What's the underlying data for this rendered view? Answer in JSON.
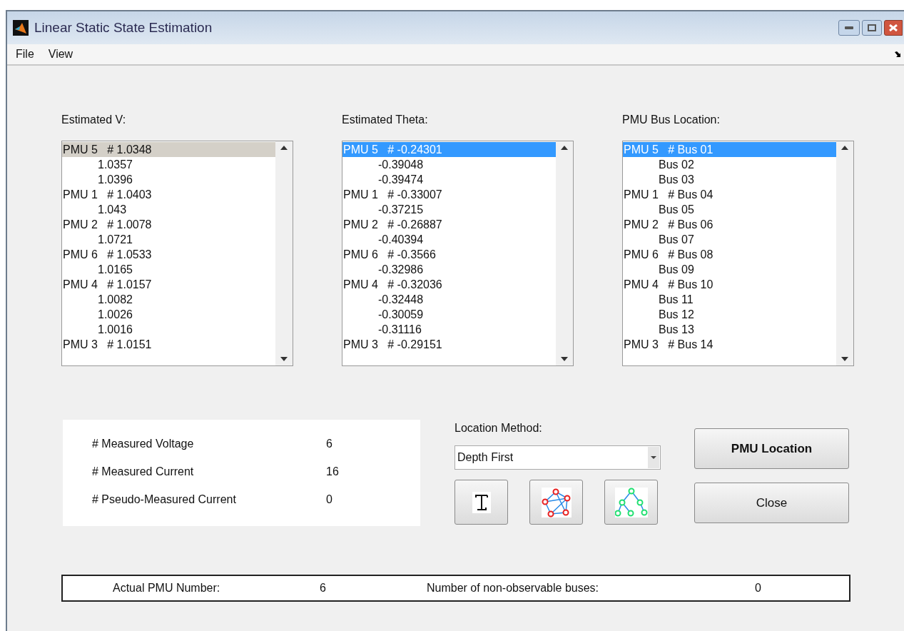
{
  "window": {
    "title": "Linear Static State Estimation"
  },
  "menu": [
    "File",
    "View"
  ],
  "lists": [
    {
      "label": "Estimated V:",
      "focused": false,
      "rows": [
        {
          "kind": "pmu",
          "text": "PMU 5   # 1.0348",
          "selected": true
        },
        {
          "kind": "value",
          "text": "1.0357",
          "selected": false
        },
        {
          "kind": "value",
          "text": "1.0396",
          "selected": false
        },
        {
          "kind": "pmu",
          "text": "PMU 1   # 1.0403",
          "selected": false
        },
        {
          "kind": "value",
          "text": "1.043",
          "selected": false
        },
        {
          "kind": "pmu",
          "text": "PMU 2   # 1.0078",
          "selected": false
        },
        {
          "kind": "value",
          "text": "1.0721",
          "selected": false
        },
        {
          "kind": "pmu",
          "text": "PMU 6   # 1.0533",
          "selected": false
        },
        {
          "kind": "value",
          "text": "1.0165",
          "selected": false
        },
        {
          "kind": "pmu",
          "text": "PMU 4   # 1.0157",
          "selected": false
        },
        {
          "kind": "value",
          "text": "1.0082",
          "selected": false
        },
        {
          "kind": "value",
          "text": "1.0026",
          "selected": false
        },
        {
          "kind": "value",
          "text": "1.0016",
          "selected": false
        },
        {
          "kind": "pmu",
          "text": "PMU 3   # 1.0151",
          "selected": false
        }
      ]
    },
    {
      "label": "Estimated Theta:",
      "focused": true,
      "rows": [
        {
          "kind": "pmu",
          "text": "PMU 5   # -0.24301",
          "selected": true
        },
        {
          "kind": "value",
          "text": "-0.39048",
          "selected": false
        },
        {
          "kind": "value",
          "text": "-0.39474",
          "selected": false
        },
        {
          "kind": "pmu",
          "text": "PMU 1   # -0.33007",
          "selected": false
        },
        {
          "kind": "value",
          "text": "-0.37215",
          "selected": false
        },
        {
          "kind": "pmu",
          "text": "PMU 2   # -0.26887",
          "selected": false
        },
        {
          "kind": "value",
          "text": "-0.40394",
          "selected": false
        },
        {
          "kind": "pmu",
          "text": "PMU 6   # -0.3566",
          "selected": false
        },
        {
          "kind": "value",
          "text": "-0.32986",
          "selected": false
        },
        {
          "kind": "pmu",
          "text": "PMU 4   # -0.32036",
          "selected": false
        },
        {
          "kind": "value",
          "text": "-0.32448",
          "selected": false
        },
        {
          "kind": "value",
          "text": "-0.30059",
          "selected": false
        },
        {
          "kind": "value",
          "text": "-0.31116",
          "selected": false
        },
        {
          "kind": "pmu",
          "text": "PMU 3   # -0.29151",
          "selected": false
        }
      ]
    },
    {
      "label": "PMU Bus Location:",
      "focused": true,
      "rows": [
        {
          "kind": "pmu",
          "text": "PMU 5   # Bus 01",
          "selected": true
        },
        {
          "kind": "value",
          "text": "Bus 02",
          "selected": false
        },
        {
          "kind": "value",
          "text": "Bus 03",
          "selected": false
        },
        {
          "kind": "pmu",
          "text": "PMU 1   # Bus 04",
          "selected": false
        },
        {
          "kind": "value",
          "text": "Bus 05",
          "selected": false
        },
        {
          "kind": "pmu",
          "text": "PMU 2   # Bus 06",
          "selected": false
        },
        {
          "kind": "value",
          "text": "Bus 07",
          "selected": false
        },
        {
          "kind": "pmu",
          "text": "PMU 6   # Bus 08",
          "selected": false
        },
        {
          "kind": "value",
          "text": "Bus 09",
          "selected": false
        },
        {
          "kind": "pmu",
          "text": "PMU 4   # Bus 10",
          "selected": false
        },
        {
          "kind": "value",
          "text": "Bus 11",
          "selected": false
        },
        {
          "kind": "value",
          "text": "Bus 12",
          "selected": false
        },
        {
          "kind": "value",
          "text": "Bus 13",
          "selected": false
        },
        {
          "kind": "pmu",
          "text": "PMU 3   # Bus 14",
          "selected": false
        }
      ]
    }
  ],
  "measurements": [
    {
      "label": "# Measured Voltage",
      "value": "6"
    },
    {
      "label": "# Measured Current",
      "value": "16"
    },
    {
      "label": "# Pseudo-Measured Current",
      "value": "0"
    }
  ],
  "location_method": {
    "label": "Location Method:",
    "value": "Depth First"
  },
  "buttons": [
    "PMU Location",
    "Close"
  ],
  "status_bar": {
    "pmu_label": "Actual PMU Number:",
    "pmu_value": "6",
    "nonobs_label": "Number of non-observable buses:",
    "nonobs_value": "0"
  }
}
